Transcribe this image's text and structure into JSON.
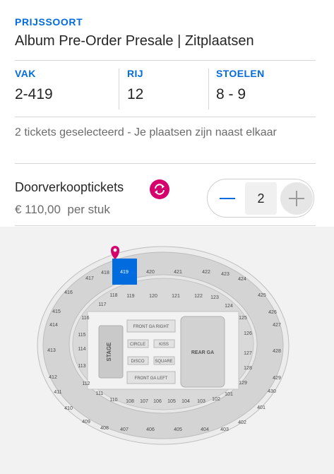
{
  "ticket": {
    "eyebrow": "PRIJSSOORT",
    "title": "Album Pre-Order Presale | Zitplaatsen"
  },
  "seat_info": {
    "section_label": "VAK",
    "section_value": "2-419",
    "row_label": "RIJ",
    "row_value": "12",
    "seats_label": "STOELEN",
    "seats_value": "8 - 9"
  },
  "selection_note": "2 tickets geselecteerd - Je plaatsen zijn naast elkaar",
  "resale": {
    "label": "Doorverkooptickets",
    "icon": "resale-refresh-icon",
    "price": "€ 110,00",
    "per_unit": "per stuk"
  },
  "quantity": {
    "value": "2",
    "minus_icon": "minus-icon",
    "plus_icon": "plus-icon"
  },
  "seatmap": {
    "selected_section": "419",
    "outer_top": [
      "417",
      "418",
      "419",
      "420",
      "421",
      "422",
      "423"
    ],
    "outer_right": [
      "424",
      "425",
      "426",
      "427",
      "428",
      "429",
      "430",
      "401",
      "402"
    ],
    "outer_bottom": [
      "403",
      "404",
      "405",
      "406",
      "407",
      "408",
      "409"
    ],
    "outer_left": [
      "410",
      "411",
      "412",
      "413",
      "414",
      "415",
      "416"
    ],
    "inner_top": [
      "117",
      "118",
      "119",
      "120",
      "121",
      "122",
      "123",
      "124"
    ],
    "inner_right": [
      "125",
      "126",
      "127",
      "128",
      "129",
      "101"
    ],
    "inner_bottom": [
      "102",
      "103",
      "104",
      "105",
      "106",
      "107",
      "108",
      "110",
      "111"
    ],
    "inner_left": [
      "112",
      "113",
      "114",
      "115",
      "116"
    ],
    "floor": {
      "stage": "STAGE",
      "front_ga_right": "FRONT GA RIGHT",
      "front_ga_left": "FRONT GA LEFT",
      "circle": "CIRCLE",
      "kiss": "KISS",
      "disco": "DISCO",
      "square": "SQUARE",
      "rear_ga": "REAR GA"
    },
    "colors": {
      "selected": "#026cdf",
      "section": "#cfcfcf",
      "floor": "#dcdcdc",
      "marker": "#d6006d"
    }
  }
}
